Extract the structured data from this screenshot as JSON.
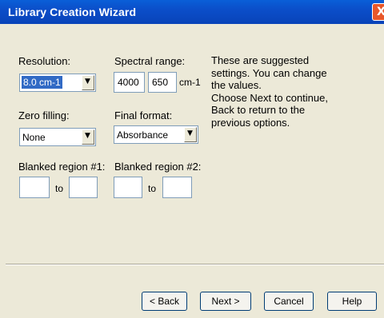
{
  "window": {
    "title": "Library Creation Wizard",
    "close_glyph": "X"
  },
  "resolution": {
    "label": "Resolution:",
    "value": "8.0 cm-1"
  },
  "spectral_range": {
    "label": "Spectral range:",
    "from": "4000",
    "to": "650",
    "unit": "cm-1"
  },
  "zero_filling": {
    "label": "Zero filling:",
    "value": "None"
  },
  "final_format": {
    "label": "Final format:",
    "value": "Absorbance"
  },
  "blanked1": {
    "label": "Blanked region #1:",
    "from": "",
    "to_label": "to",
    "to": ""
  },
  "blanked2": {
    "label": "Blanked region #2:",
    "from": "",
    "to_label": "to",
    "to": ""
  },
  "note": {
    "line1": "These are suggested",
    "line2": "settings. You can change",
    "line3": "the values.",
    "line4": "Choose Next to continue,",
    "line5": "Back to return to the",
    "line6": "previous options."
  },
  "buttons": {
    "back": "< Back",
    "next": "Next >",
    "cancel": "Cancel",
    "help": "Help"
  },
  "icons": {
    "dropdown": "dropdown-arrow-icon",
    "close": "close-icon"
  }
}
